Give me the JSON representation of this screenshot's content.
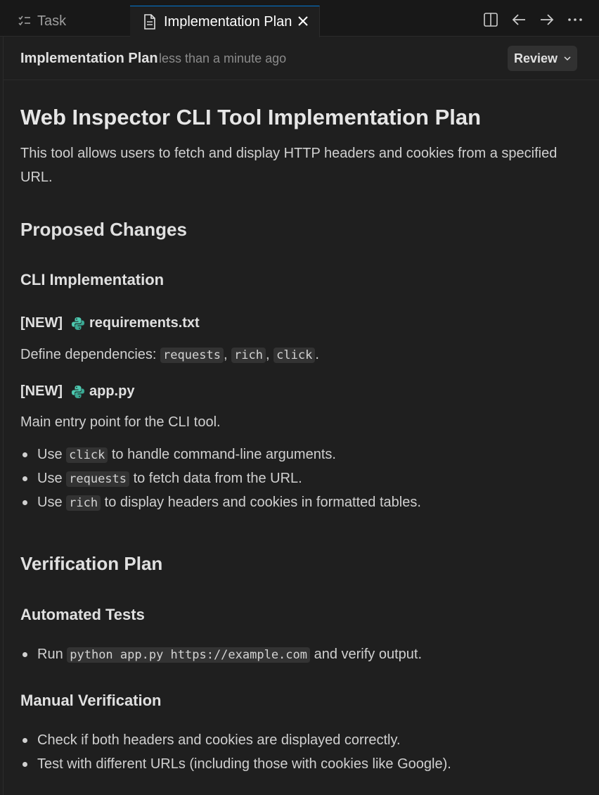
{
  "tabs": {
    "task_label": "Task",
    "active_label": "Implementation Plan"
  },
  "header": {
    "title": "Implementation Plan",
    "timestamp": "less than a minute ago",
    "review_label": "Review"
  },
  "doc": {
    "title": "Web Inspector CLI Tool Implementation Plan",
    "intro": "This tool allows users to fetch and display HTTP headers and cookies from a specified URL.",
    "proposed_heading": "Proposed Changes",
    "cli_heading": "CLI Implementation",
    "req": {
      "tag": "[NEW]",
      "file": "requirements.txt",
      "desc_prefix": "Define dependencies: ",
      "deps": [
        "requests",
        "rich",
        "click"
      ],
      "sep": ", ",
      "suffix": "."
    },
    "app": {
      "tag": "[NEW]",
      "file": "app.py",
      "desc": "Main entry point for the CLI tool.",
      "bullets": [
        {
          "pre": "Use ",
          "code": "click",
          "post": " to handle command-line arguments."
        },
        {
          "pre": "Use ",
          "code": "requests",
          "post": " to fetch data from the URL."
        },
        {
          "pre": "Use ",
          "code": "rich",
          "post": " to display headers and cookies in formatted tables."
        }
      ]
    },
    "verification_heading": "Verification Plan",
    "automated_heading": "Automated Tests",
    "automated_bullet": {
      "pre": "Run ",
      "code": "python app.py https://example.com",
      "post": " and verify output."
    },
    "manual_heading": "Manual Verification",
    "manual_bullets": [
      "Check if both headers and cookies are displayed correctly.",
      "Test with different URLs (including those with cookies like Google)."
    ]
  },
  "colors": {
    "background": "#1f1f1f",
    "tabbar": "#181818",
    "accent": "#0078d4",
    "python_icon": "#4ec9b0"
  },
  "icons": {
    "task_tab": "checklist-icon",
    "active_tab": "document-icon",
    "close": "close-icon",
    "split": "split-editor-icon",
    "back": "arrow-left-icon",
    "forward": "arrow-right-icon",
    "more": "more-icon",
    "file_type": "python-icon",
    "review_dropdown": "chevron-down-icon"
  }
}
